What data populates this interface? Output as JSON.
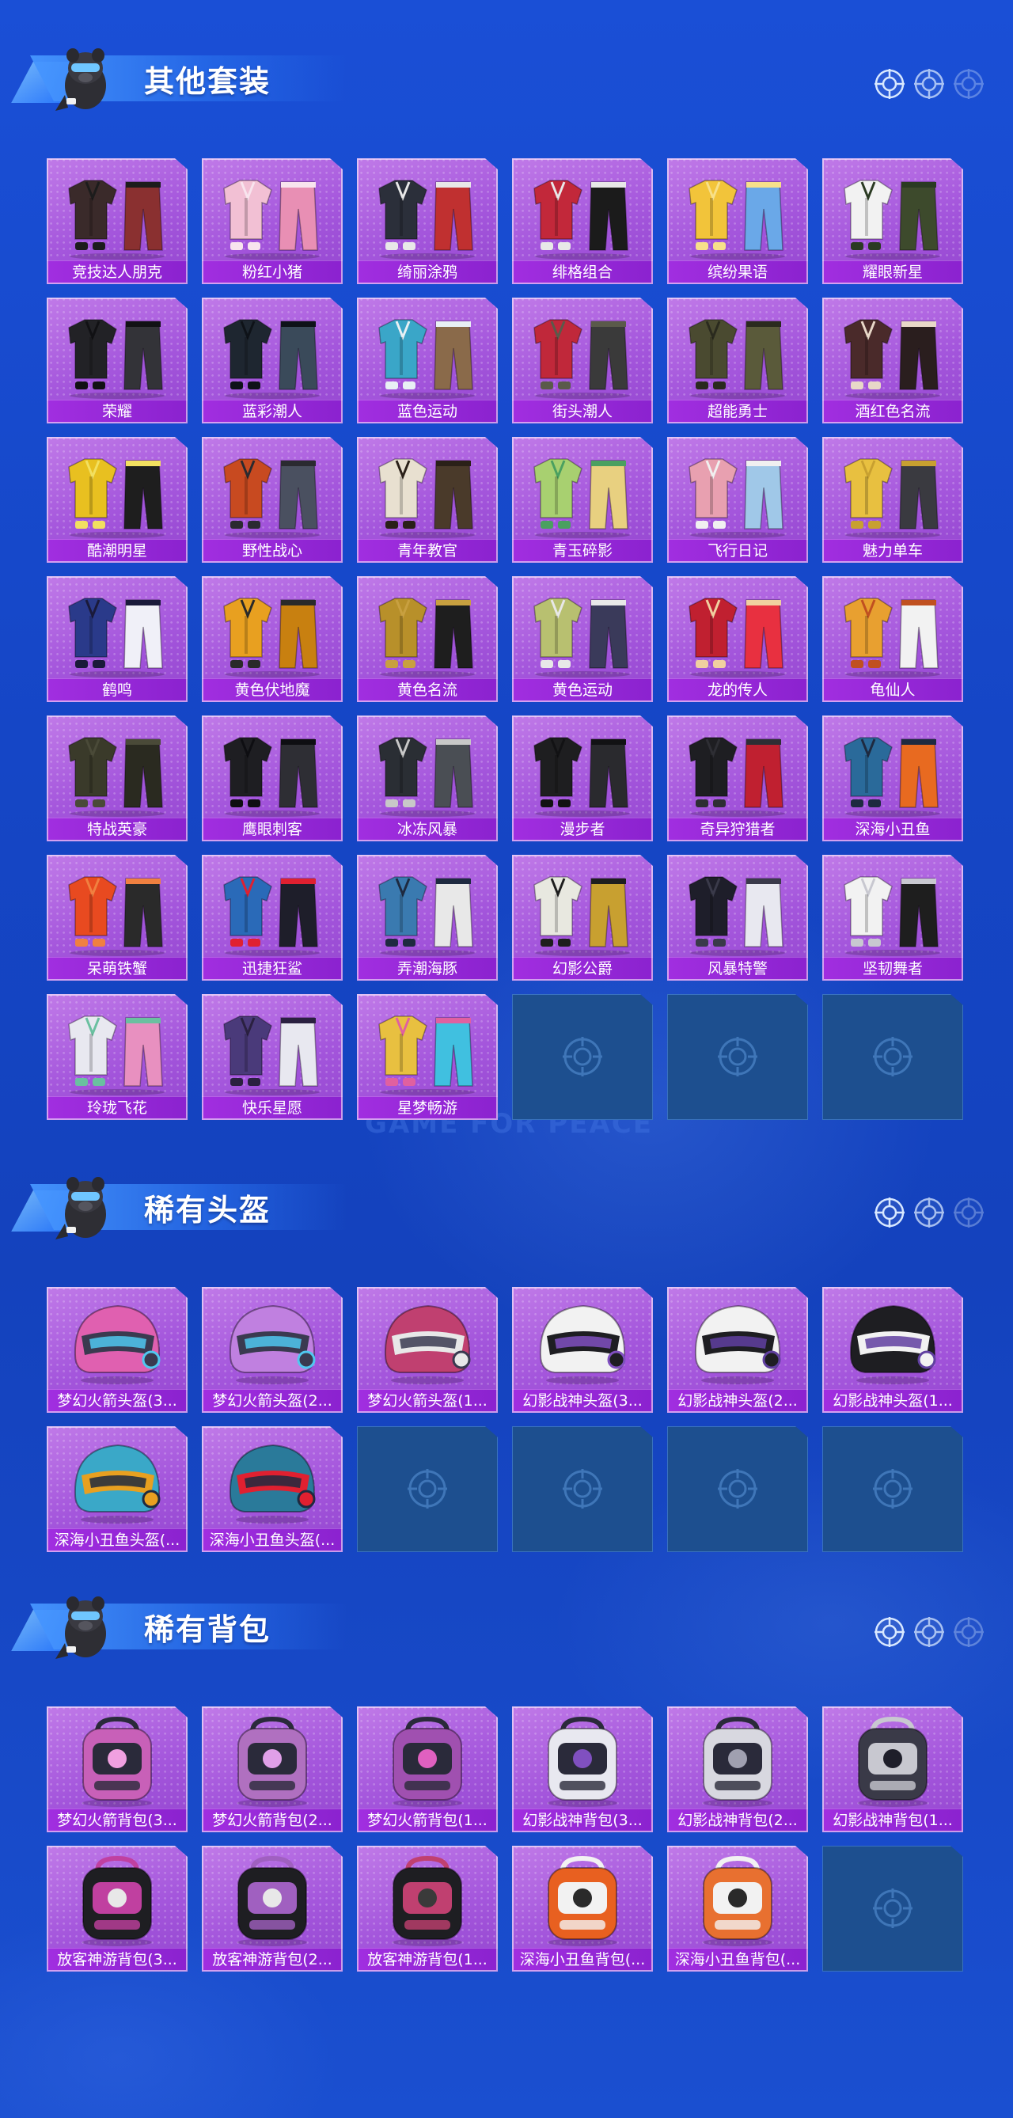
{
  "background_watermark": "GAME FOR PEACE",
  "colors": {
    "page_bg": "#1546c6",
    "tile_bg": "#a456dc",
    "tile_label_bg": "#9a2adb",
    "empty_slot_bg": "#1d4f8f"
  },
  "sections": [
    {
      "title": "其他套装",
      "items": [
        {
          "name": "竞技达人朋克",
          "icon": "outfit-icon",
          "palette": [
            "#3a2a2a",
            "#8a3030",
            "#1c1c1c"
          ]
        },
        {
          "name": "粉红小猪",
          "icon": "outfit-icon",
          "palette": [
            "#f2c0d4",
            "#e88fb4",
            "#f8e4ee"
          ]
        },
        {
          "name": "绮丽涂鸦",
          "icon": "outfit-icon",
          "palette": [
            "#2b2f3a",
            "#c03030",
            "#e8e8e8"
          ]
        },
        {
          "name": "绯格组合",
          "icon": "outfit-icon",
          "palette": [
            "#c2283a",
            "#1b1b1b",
            "#e8e8e8"
          ]
        },
        {
          "name": "缤纷果语",
          "icon": "outfit-icon",
          "palette": [
            "#f2c43a",
            "#6aa8e8",
            "#f7e08a"
          ]
        },
        {
          "name": "耀眼新星",
          "icon": "outfit-icon",
          "palette": [
            "#f2f2f2",
            "#3d4a2c",
            "#2a3a22"
          ]
        },
        {
          "name": "荣耀",
          "icon": "outfit-icon",
          "palette": [
            "#222226",
            "#333338",
            "#111114"
          ]
        },
        {
          "name": "蓝彩潮人",
          "icon": "outfit-icon",
          "palette": [
            "#1e2630",
            "#3a4a5a",
            "#0e1218"
          ]
        },
        {
          "name": "蓝色运动",
          "icon": "outfit-icon",
          "palette": [
            "#3aa6c8",
            "#8a6a4a",
            "#e8f0f4"
          ]
        },
        {
          "name": "街头潮人",
          "icon": "outfit-icon",
          "palette": [
            "#c0283a",
            "#3a3a3a",
            "#5a5a4a"
          ]
        },
        {
          "name": "超能勇士",
          "icon": "outfit-icon",
          "palette": [
            "#4a4a30",
            "#5a5a3a",
            "#2a2a1e"
          ]
        },
        {
          "name": "酒红色名流",
          "icon": "outfit-icon",
          "palette": [
            "#4a2a2a",
            "#2a1e1e",
            "#e8d8c8"
          ]
        },
        {
          "name": "酷潮明星",
          "icon": "outfit-icon",
          "palette": [
            "#e8c020",
            "#1e1e1e",
            "#f2e060"
          ]
        },
        {
          "name": "野性战心",
          "icon": "outfit-icon",
          "palette": [
            "#c84a20",
            "#4a5060",
            "#2a2a30"
          ]
        },
        {
          "name": "青年教官",
          "icon": "outfit-icon",
          "palette": [
            "#e8e0d0",
            "#4a3a2a",
            "#2a2018"
          ]
        },
        {
          "name": "青玉碎影",
          "icon": "outfit-icon",
          "palette": [
            "#a8d070",
            "#e8d080",
            "#4aa060"
          ]
        },
        {
          "name": "飞行日记",
          "icon": "outfit-icon",
          "palette": [
            "#e8a0b0",
            "#a0c8e8",
            "#f0f0f0"
          ]
        },
        {
          "name": "魅力单车",
          "icon": "outfit-icon",
          "palette": [
            "#e8c040",
            "#3a3a40",
            "#c8a030"
          ]
        },
        {
          "name": "鹤鸣",
          "icon": "outfit-icon",
          "palette": [
            "#2a3a8a",
            "#f0f0f8",
            "#1a1a3a"
          ]
        },
        {
          "name": "黄色伏地魔",
          "icon": "outfit-icon",
          "palette": [
            "#e8a020",
            "#c88010",
            "#2a2a2a"
          ]
        },
        {
          "name": "黄色名流",
          "icon": "outfit-icon",
          "palette": [
            "#b8902a",
            "#1e1e1e",
            "#c8a040"
          ]
        },
        {
          "name": "黄色运动",
          "icon": "outfit-icon",
          "palette": [
            "#b8c070",
            "#3a3a5a",
            "#e8e8e8"
          ]
        },
        {
          "name": "龙的传人",
          "icon": "outfit-icon",
          "palette": [
            "#c02030",
            "#e83040",
            "#f0d0a0"
          ]
        },
        {
          "name": "龟仙人",
          "icon": "outfit-icon",
          "palette": [
            "#e8a030",
            "#f2f2f2",
            "#c05020"
          ]
        },
        {
          "name": "特战英豪",
          "icon": "outfit-icon",
          "palette": [
            "#3a3a2a",
            "#2a2a20",
            "#4a4a38"
          ]
        },
        {
          "name": "鹰眼刺客",
          "icon": "outfit-icon",
          "palette": [
            "#1e1e22",
            "#2e2e34",
            "#0e0e12"
          ]
        },
        {
          "name": "冰冻风暴",
          "icon": "outfit-icon",
          "palette": [
            "#2a2e34",
            "#4a4e54",
            "#c8c8c8"
          ]
        },
        {
          "name": "漫步者",
          "icon": "outfit-icon",
          "palette": [
            "#1e1e20",
            "#2a2a2e",
            "#121214"
          ]
        },
        {
          "name": "奇异狩猎者",
          "icon": "outfit-icon",
          "palette": [
            "#1e1e22",
            "#c02030",
            "#2e2e34"
          ]
        },
        {
          "name": "深海小丑鱼",
          "icon": "outfit-icon",
          "palette": [
            "#2a6a9a",
            "#e86a20",
            "#1e2a40"
          ]
        },
        {
          "name": "呆萌铁蟹",
          "icon": "outfit-icon",
          "palette": [
            "#e84a20",
            "#2a2a2a",
            "#f08040"
          ]
        },
        {
          "name": "迅捷狂鲨",
          "icon": "outfit-icon",
          "palette": [
            "#2a6ab8",
            "#1e1e2a",
            "#e02030"
          ]
        },
        {
          "name": "弄潮海豚",
          "icon": "outfit-icon",
          "palette": [
            "#3a7ab0",
            "#e8e8e8",
            "#1e2a40"
          ]
        },
        {
          "name": "幻影公爵",
          "icon": "outfit-icon",
          "palette": [
            "#e8e8e0",
            "#c8a030",
            "#1e1e1e"
          ]
        },
        {
          "name": "风暴特警",
          "icon": "outfit-icon",
          "palette": [
            "#1e1e2a",
            "#e8e8f0",
            "#3a3a4a"
          ]
        },
        {
          "name": "坚韧舞者",
          "icon": "outfit-icon",
          "palette": [
            "#f2f2f2",
            "#1e1e1e",
            "#c8c8d0"
          ]
        },
        {
          "name": "玲珑飞花",
          "icon": "outfit-icon",
          "palette": [
            "#e8e8f0",
            "#e890c0",
            "#6ac0a0"
          ]
        },
        {
          "name": "快乐星愿",
          "icon": "outfit-icon",
          "palette": [
            "#4a3a7a",
            "#e8e8f0",
            "#2a2040"
          ]
        },
        {
          "name": "星梦畅游",
          "icon": "outfit-icon",
          "palette": [
            "#e8c040",
            "#40c0e0",
            "#e060a0"
          ]
        }
      ],
      "empty_slots": 3
    },
    {
      "title": "稀有头盔",
      "items": [
        {
          "name": "梦幻火箭头盔(3...",
          "icon": "helmet-icon",
          "palette": [
            "#e060b0",
            "#3a3a50",
            "#50c8f0"
          ]
        },
        {
          "name": "梦幻火箭头盔(2...",
          "icon": "helmet-icon",
          "palette": [
            "#c080e0",
            "#3a3a50",
            "#50c8f0"
          ]
        },
        {
          "name": "梦幻火箭头盔(1...",
          "icon": "helmet-icon",
          "palette": [
            "#c04070",
            "#e8e8e8",
            "#3a3a50"
          ]
        },
        {
          "name": "幻影战神头盔(3...",
          "icon": "helmet-icon",
          "palette": [
            "#f2f2f2",
            "#1e1e22",
            "#8050c0"
          ]
        },
        {
          "name": "幻影战神头盔(2...",
          "icon": "helmet-icon",
          "palette": [
            "#f2f2f2",
            "#1e1e22",
            "#6040a0"
          ]
        },
        {
          "name": "幻影战神头盔(1...",
          "icon": "helmet-icon",
          "palette": [
            "#1e1e22",
            "#f2f2f2",
            "#6040a0"
          ]
        },
        {
          "name": "深海小丑鱼头盔(...",
          "icon": "helmet-icon",
          "palette": [
            "#3aa8c8",
            "#e8a020",
            "#1e2a40"
          ]
        },
        {
          "name": "深海小丑鱼头盔(...",
          "icon": "helmet-icon",
          "palette": [
            "#2a7a9a",
            "#e02030",
            "#1e2a40"
          ]
        }
      ],
      "empty_slots": 4
    },
    {
      "title": "稀有背包",
      "items": [
        {
          "name": "梦幻火箭背包(3...",
          "icon": "backpack-icon",
          "palette": [
            "#c860b8",
            "#2a2a3a",
            "#f0a0e0"
          ]
        },
        {
          "name": "梦幻火箭背包(2...",
          "icon": "backpack-icon",
          "palette": [
            "#b070c0",
            "#2a2a3a",
            "#e0a0e8"
          ]
        },
        {
          "name": "梦幻火箭背包(1...",
          "icon": "backpack-icon",
          "palette": [
            "#a050b0",
            "#2a2a3a",
            "#e060c0"
          ]
        },
        {
          "name": "幻影战神背包(3...",
          "icon": "backpack-icon",
          "palette": [
            "#e8e8f0",
            "#2a2a3a",
            "#8050c0"
          ]
        },
        {
          "name": "幻影战神背包(2...",
          "icon": "backpack-icon",
          "palette": [
            "#d8d8e0",
            "#2a2a3a",
            "#a0a0b0"
          ]
        },
        {
          "name": "幻影战神背包(1...",
          "icon": "backpack-icon",
          "palette": [
            "#3a3a48",
            "#c8c8d0",
            "#1e1e2a"
          ]
        },
        {
          "name": "放客神游背包(3...",
          "icon": "backpack-icon",
          "palette": [
            "#1e1e22",
            "#c040a0",
            "#e8e8e8"
          ]
        },
        {
          "name": "放客神游背包(2...",
          "icon": "backpack-icon",
          "palette": [
            "#1e1e22",
            "#a060c0",
            "#e8e8e8"
          ]
        },
        {
          "name": "放客神游背包(1...",
          "icon": "backpack-icon",
          "palette": [
            "#1e1e22",
            "#c04070",
            "#3a3a3a"
          ]
        },
        {
          "name": "深海小丑鱼背包(...",
          "icon": "backpack-icon",
          "palette": [
            "#e86020",
            "#f2f2f2",
            "#2a2a2a"
          ]
        },
        {
          "name": "深海小丑鱼背包(...",
          "icon": "backpack-icon",
          "palette": [
            "#e87030",
            "#f2f2f2",
            "#2a2a2a"
          ]
        }
      ],
      "empty_slots": 1
    }
  ]
}
